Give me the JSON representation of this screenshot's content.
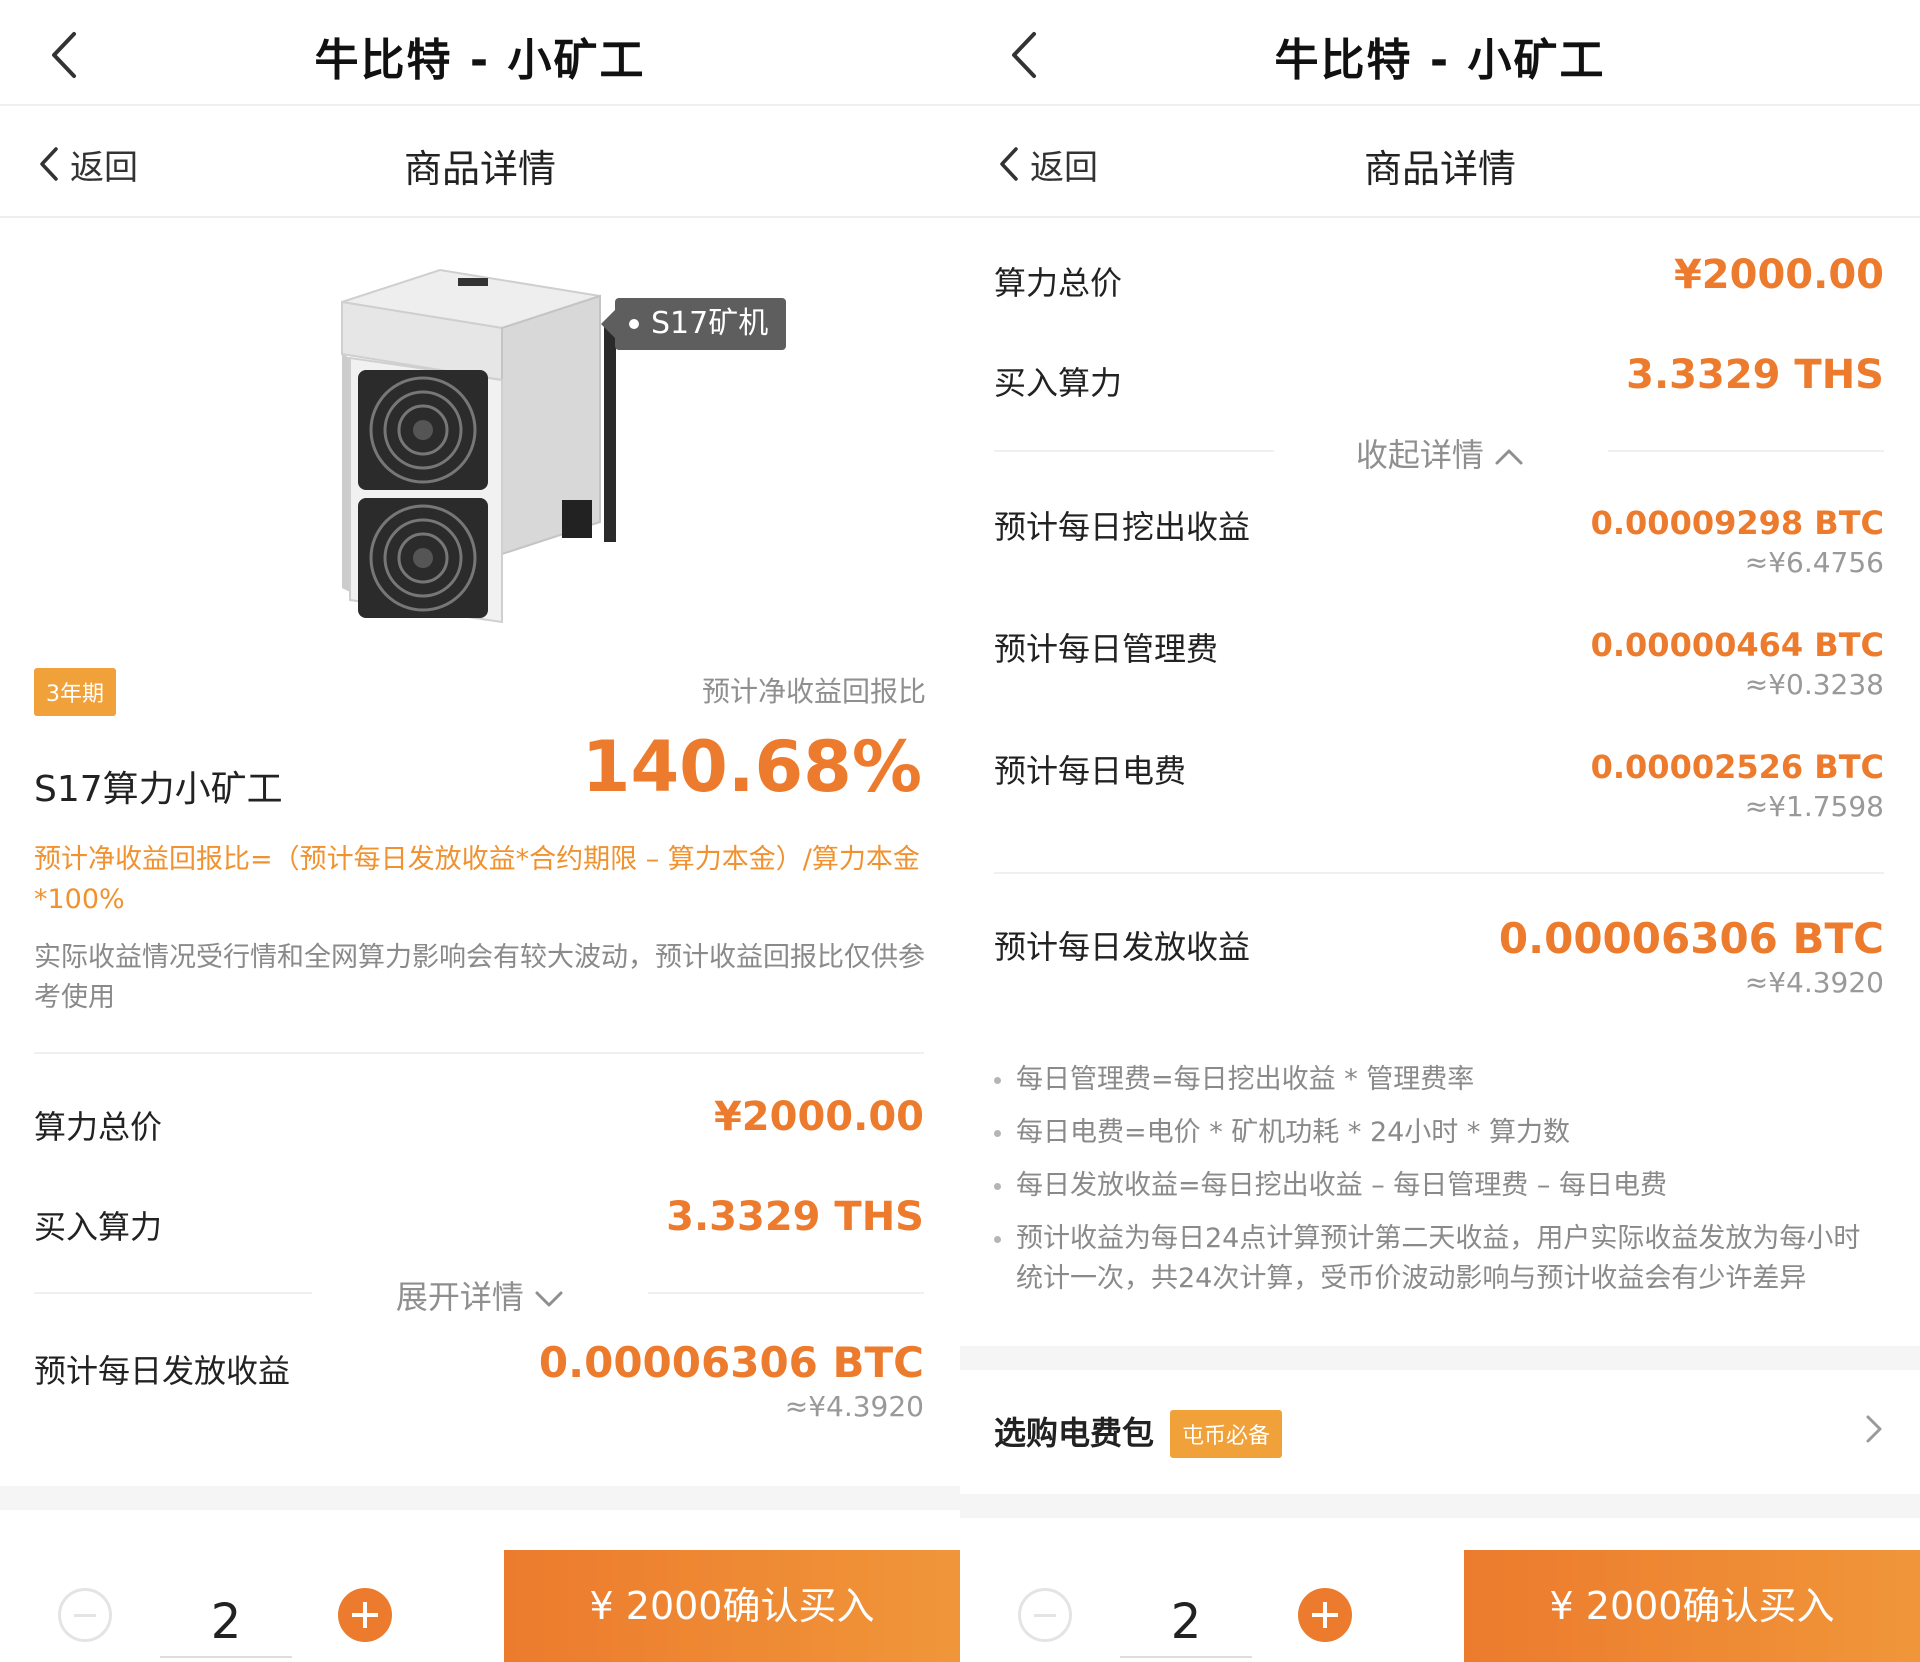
{
  "app": {
    "title": "牛比特 - 小矿工"
  },
  "subnav": {
    "back_label": "返回",
    "title": "商品详情"
  },
  "product": {
    "image_tag": "S17矿机",
    "term_badge": "3年期",
    "name": "S17算力小矿工",
    "ratio_label": "预计净收益回报比",
    "ratio_value": "140.68%",
    "formula": "预计净收益回报比=（预计每日发放收益*合约期限 – 算力本金）/算力本金*100%",
    "disclaimer": "实际收益情况受行情和全网算力影响会有较大波动，预计收益回报比仅供参考使用"
  },
  "summary": {
    "total_price_label": "算力总价",
    "total_price_value": "¥2000.00",
    "hashrate_label": "买入算力",
    "hashrate_value": "3.3329 THS",
    "expand_label": "展开详情",
    "collapse_label": "收起详情",
    "daily_payout_label": "预计每日发放收益",
    "daily_payout_value": "0.00006306 BTC",
    "daily_payout_cny": "≈¥4.3920"
  },
  "details": [
    {
      "label": "预计每日挖出收益",
      "value": "0.00009298 BTC",
      "cny": "≈¥6.4756"
    },
    {
      "label": "预计每日管理费",
      "value": "0.00000464 BTC",
      "cny": "≈¥0.3238"
    },
    {
      "label": "预计每日电费",
      "value": "0.00002526 BTC",
      "cny": "≈¥1.7598"
    }
  ],
  "notes": [
    "每日管理费=每日挖出收益 * 管理费率",
    "每日电费=电价 * 矿机功耗 * 24小时 * 算力数",
    "每日发放收益=每日挖出收益 – 每日管理费 – 每日电费",
    "预计收益为每日24点计算预计第二天收益，用户实际收益发放为每小时统计一次，共24次计算，受币价波动影响与预计收益会有少许差异"
  ],
  "electricity": {
    "label": "选购电费包",
    "badge": "屯币必备"
  },
  "order": {
    "quantity": "2",
    "buy_label": "¥ 2000确认买入"
  },
  "colors": {
    "accent": "#ec7b2d",
    "badge": "#f0a13a",
    "muted": "#8a8a8a"
  }
}
